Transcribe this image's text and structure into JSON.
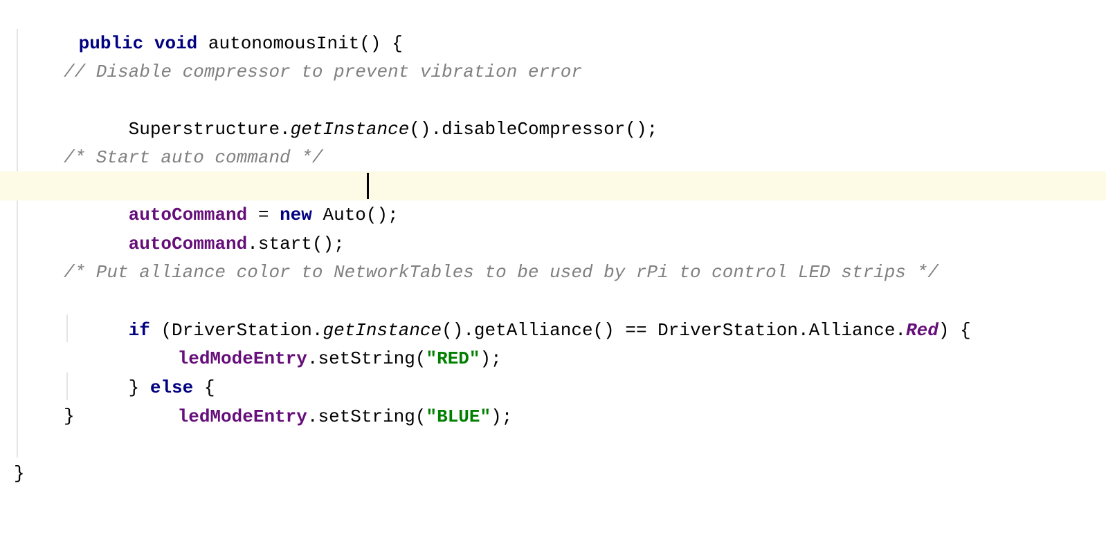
{
  "editor": {
    "lines": {
      "l0": {
        "kw1": "public",
        "kw2": "void",
        "rest": "autonomousInit() {"
      },
      "l2": {
        "comment": "// Disable compressor to prevent vibration error"
      },
      "l3": {
        "cls": "Superstructure.",
        "method_it": "getInstance",
        "rest": "().disableCompressor();"
      },
      "l5": {
        "comment": "/* Start auto command */"
      },
      "l6": {
        "field": "autoCommand",
        "op": " = ",
        "kw": "new",
        "rest": " Auto();"
      },
      "l7": {
        "field": "autoCommand",
        "rest": ".start();"
      },
      "l9": {
        "comment": "/* Put alliance color to NetworkTables to be used by rPi to control LED strips */"
      },
      "l10": {
        "kw": "if",
        "p1": " (DriverStation.",
        "method_it": "getInstance",
        "p2": "().getAlliance() == DriverStation.Alliance.",
        "static_field": "Red",
        "p3": ") {"
      },
      "l11": {
        "field": "ledModeEntry",
        "p1": ".setString(",
        "str": "\"RED\"",
        "p2": ");"
      },
      "l12": {
        "p1": "} ",
        "kw": "else",
        "p2": " {"
      },
      "l13": {
        "field": "ledModeEntry",
        "p1": ".setString(",
        "str": "\"BLUE\"",
        "p2": ");"
      },
      "l14": {
        "brace": "}"
      },
      "l16": {
        "brace": "}"
      }
    }
  }
}
